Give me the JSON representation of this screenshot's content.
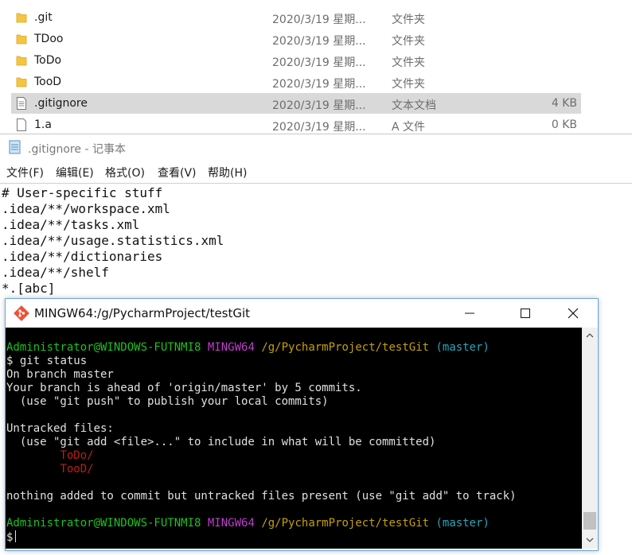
{
  "explorer": {
    "files": [
      {
        "icon": "folder-icon",
        "name": ".git",
        "date": "2020/3/19 星期...",
        "type": "文件夹",
        "size": "",
        "selected": false
      },
      {
        "icon": "folder-icon",
        "name": "TDoo",
        "date": "2020/3/19 星期...",
        "type": "文件夹",
        "size": "",
        "selected": false
      },
      {
        "icon": "folder-icon",
        "name": "ToDo",
        "date": "2020/3/19 星期...",
        "type": "文件夹",
        "size": "",
        "selected": false
      },
      {
        "icon": "folder-icon",
        "name": "TooD",
        "date": "2020/3/19 星期...",
        "type": "文件夹",
        "size": "",
        "selected": false
      },
      {
        "icon": "text-file-icon",
        "name": ".gitignore",
        "date": "2020/3/19 星期...",
        "type": "文本文档",
        "size": "4 KB",
        "selected": true
      },
      {
        "icon": "file-icon",
        "name": "1.a",
        "date": "2020/3/19 星期...",
        "type": "A 文件",
        "size": "0 KB",
        "selected": false
      }
    ],
    "colors": {
      "folder": "#f5c542",
      "selected_row": "#d9d9d9"
    }
  },
  "notepad": {
    "title": ".gitignore - 记事本",
    "menu": [
      "文件(F)",
      "编辑(E)",
      "格式(O)",
      "查看(V)",
      "帮助(H)"
    ],
    "lines": [
      "# User-specific stuff",
      ".idea/**/workspace.xml",
      ".idea/**/tasks.xml",
      ".idea/**/usage.statistics.xml",
      ".idea/**/dictionaries",
      ".idea/**/shelf",
      "*.[abc]"
    ]
  },
  "terminal": {
    "title": "MINGW64:/g/PycharmProject/testGit",
    "prompt": {
      "user": "Administrator@WINDOWS-FUTNMI8",
      "env": "MINGW64",
      "path": "/g/PycharmProject/testGit",
      "branch": "(master)",
      "symbol": "$"
    },
    "command": "git status",
    "output": [
      "On branch master",
      "Your branch is ahead of 'origin/master' by 5 commits.",
      "  (use \"git push\" to publish your local commits)",
      "",
      "Untracked files:",
      "  (use \"git add <file>...\" to include in what will be committed)"
    ],
    "untracked": [
      "ToDo/",
      "TooD/"
    ],
    "summary": "nothing added to commit but untracked files present (use \"git add\" to track)",
    "colors": {
      "user": "#1bc41b",
      "env": "#c23bd0",
      "path": "#c4a000",
      "branch": "#2aa6b8",
      "untracked": "#c01c1c"
    }
  }
}
